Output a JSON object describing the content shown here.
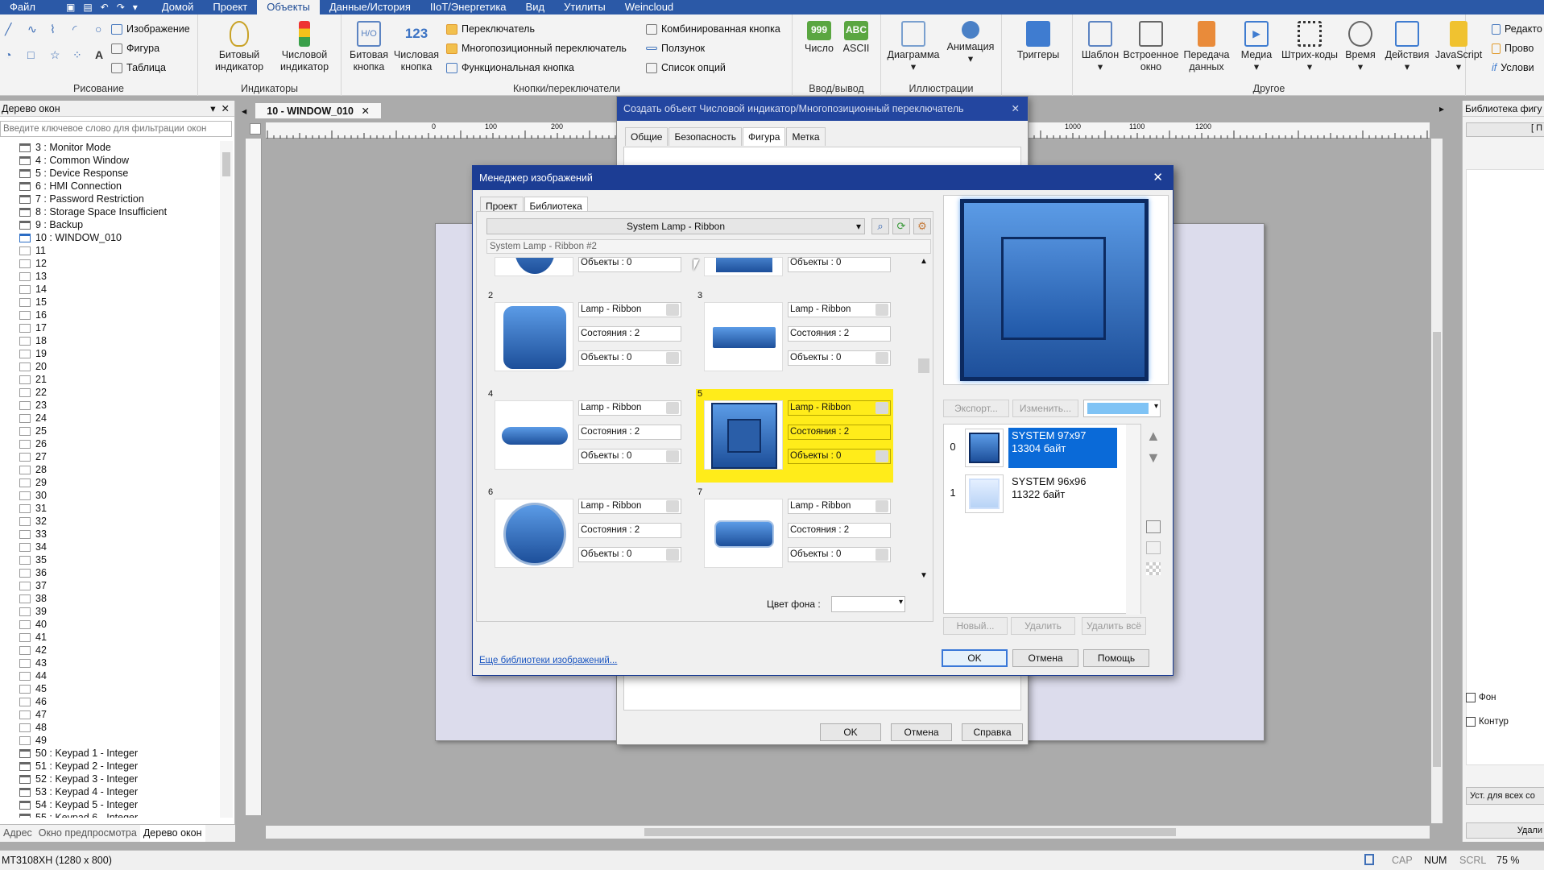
{
  "menubar": {
    "items": [
      "Файл",
      "Домой",
      "Проект",
      "Объекты",
      "Данные/История",
      "IIoT/Энергетика",
      "Вид",
      "Утилиты",
      "Weincloud"
    ],
    "active_index": 3
  },
  "ribbon": {
    "drawing": {
      "image": "Изображение",
      "shape": "Фигура",
      "table": "Таблица",
      "label": "Рисование"
    },
    "indicators": {
      "bit": "Битовый\nиндикатор",
      "numeric": "Числовой\nиндикатор",
      "label": "Индикаторы"
    },
    "buttons": {
      "bit_button": "Битовая\nкнопка",
      "num_button": "Числовая\nкнопка",
      "switch": "Переключатель",
      "multistate": "Многопозиционный переключатель",
      "function": "Функциональная кнопка",
      "combo": "Комбинированная кнопка",
      "slider": "Ползунок",
      "options": "Список опций",
      "label": "Кнопки/переключатели"
    },
    "io": {
      "number": "Число",
      "ascii": "ASCII",
      "label": "Ввод/вывод",
      "num_icon": "999",
      "ascii_icon": "ABC"
    },
    "illustrations": {
      "chart": "Диаграмма",
      "animation": "Анимация",
      "label": "Иллюстрации"
    },
    "triggers": "Триггеры",
    "other": {
      "template": "Шаблон",
      "embedded": "Встроенное\nокно",
      "transfer": "Передача\nданных",
      "media": "Медиа",
      "barcode": "Штрих-коды",
      "time": "Время",
      "actions": "Действия",
      "javascript": "JavaScript",
      "label": "Другое"
    },
    "right_cut": [
      "Редакто",
      "Прово",
      "Услови"
    ]
  },
  "left_panel": {
    "title": "Дерево окон",
    "filter_placeholder": "Введите ключевое слово для фильтрации окон",
    "named_rows": [
      "3 : Monitor Mode",
      "4 : Common Window",
      "5 : Device Response",
      "6 : HMI Connection",
      "7 : Password Restriction",
      "8 : Storage Space Insufficient",
      "9 : Backup",
      "10 : WINDOW_010"
    ],
    "numbered_rows": [
      "11",
      "12",
      "13",
      "14",
      "15",
      "16",
      "17",
      "18",
      "19",
      "20",
      "21",
      "22",
      "23",
      "24",
      "25",
      "26",
      "27",
      "28",
      "29",
      "30",
      "31",
      "32",
      "33",
      "34",
      "35",
      "36",
      "37",
      "38",
      "39",
      "40",
      "41",
      "42",
      "43",
      "44",
      "45",
      "46",
      "47",
      "48",
      "49"
    ],
    "keypad_rows": [
      "50 : Keypad 1 - Integer",
      "51 : Keypad 2 - Integer",
      "52 : Keypad 3 - Integer",
      "53 : Keypad 4 - Integer",
      "54 : Keypad 5 - Integer",
      "55 : Keypad 6 - Integer"
    ],
    "tabs": [
      "Адрес",
      "Окно предпросмотра",
      "Дерево окон"
    ]
  },
  "doc": {
    "tab": "10 - WINDOW_010",
    "ruler": [
      "0",
      "100",
      "200",
      "1000",
      "1100",
      "1200"
    ]
  },
  "back_dialog": {
    "title": "Создать объект Числовой индикатор/Многопозиционный переключатель",
    "tabs": [
      "Общие",
      "Безопасность",
      "Фигура",
      "Метка"
    ],
    "ok": "OK",
    "cancel": "Отмена",
    "help": "Справка"
  },
  "image_manager": {
    "title": "Менеджер изображений",
    "tabs": [
      "Проект",
      "Библиотека"
    ],
    "library": "System Lamp - Ribbon",
    "subtitle": "System Lamp - Ribbon #2",
    "top_objects": "Объекты : 0",
    "cells": [
      {
        "num": "2",
        "name": "Lamp - Ribbon",
        "states": "Состояния : 2",
        "objects": "Объекты : 0"
      },
      {
        "num": "3",
        "name": "Lamp - Ribbon",
        "states": "Состояния : 2",
        "objects": "Объекты : 0"
      },
      {
        "num": "4",
        "name": "Lamp - Ribbon",
        "states": "Состояния : 2",
        "objects": "Объекты : 0"
      },
      {
        "num": "5",
        "name": "Lamp - Ribbon",
        "states": "Состояния : 2",
        "objects": "Объекты : 0"
      },
      {
        "num": "6",
        "name": "Lamp - Ribbon",
        "states": "Состояния : 2",
        "objects": "Объекты : 0"
      },
      {
        "num": "7",
        "name": "Lamp - Ribbon",
        "states": "Состояния : 2",
        "objects": "Объекты : 0"
      }
    ],
    "selected_cell": "5",
    "bg_color_label": "Цвет фона :",
    "more_libs": "Еще библиотеки изображений...",
    "export": "Экспорт...",
    "change": "Изменить...",
    "states": [
      {
        "idx": "0",
        "name": "SYSTEM 97x97",
        "size": "13304 байт"
      },
      {
        "idx": "1",
        "name": "SYSTEM 96x96",
        "size": "11322 байт"
      }
    ],
    "new": "Новый...",
    "delete": "Удалить",
    "delete_all": "Удалить всё",
    "ok": "OK",
    "cancel": "Отмена",
    "help": "Помощь",
    "accent_color": "#1c3d94",
    "selection_color": "#ffec1a"
  },
  "right_panel": {
    "title": "Библиотека фигу",
    "fill": "Фон",
    "outline": "Контур",
    "apply_all": "Уст. для всех со",
    "delete": "Удали",
    "top_btn": "[ П"
  },
  "status": {
    "device": "MT3108XH (1280 x 800)",
    "cap": "CAP",
    "num": "NUM",
    "scrl": "SCRL",
    "zoom": "75 %"
  }
}
